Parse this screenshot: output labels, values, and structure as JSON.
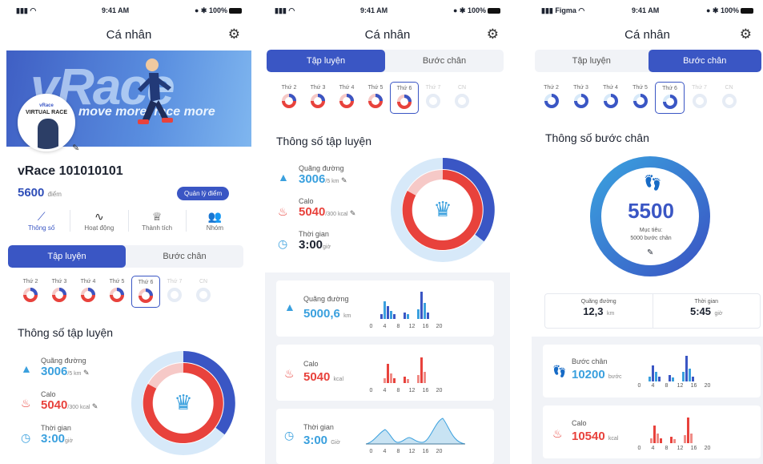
{
  "status": {
    "carrier3": "Figma",
    "time": "9:41 AM",
    "battery": "100%"
  },
  "title": "Cá nhân",
  "profile": {
    "banner_big": "vRace",
    "banner_tag": "move more, race more",
    "avatar_top": "vRace",
    "avatar_title": "VIRTUAL RACE",
    "name": "vRace 101010101",
    "points": "5600",
    "points_unit": "điểm",
    "manage_btn": "Quản lý điểm"
  },
  "nav": [
    {
      "label": "Thông số",
      "icon": "chart-line-icon"
    },
    {
      "label": "Hoạt động",
      "icon": "activity-icon"
    },
    {
      "label": "Thành tích",
      "icon": "trophy-icon"
    },
    {
      "label": "Nhóm",
      "icon": "group-icon"
    }
  ],
  "tabs": {
    "train": "Tập luyện",
    "steps": "Bước chân"
  },
  "days": [
    "Thứ 2",
    "Thứ 3",
    "Thứ 4",
    "Thứ 5",
    "Thứ 6",
    "Thứ 7",
    "CN"
  ],
  "train_title": "Thông số tập luyện",
  "steps_title": "Thông số bước chân",
  "train_stats": {
    "distance": {
      "label": "Quãng đường",
      "value": "3006",
      "unit": "/5 km"
    },
    "calo": {
      "label": "Calo",
      "value": "5040",
      "unit": "/300 kcal"
    },
    "time": {
      "label": "Thời gian",
      "value": "3:00",
      "unit": "giờ"
    }
  },
  "cards2": {
    "distance": {
      "label": "Quãng đường",
      "value": "5000,6",
      "unit": "km"
    },
    "calo": {
      "label": "Calo",
      "value": "5040",
      "unit": "kcal"
    },
    "time": {
      "label": "Thời gian",
      "value": "3:00",
      "unit": "Giờ"
    },
    "axis": [
      "0",
      "4",
      "8",
      "12",
      "16",
      "20"
    ]
  },
  "steps": {
    "value": "5500",
    "goal_label": "Mục tiêu:",
    "goal_value": "5000 bước chân",
    "distance_label": "Quãng đường",
    "distance": "12,3",
    "distance_unit": "km",
    "time_label": "Thời gian",
    "time": "5:45",
    "time_unit": "giờ"
  },
  "cards3": {
    "steps": {
      "label": "Bước chân",
      "value": "10200",
      "unit": "bước"
    },
    "calo": {
      "label": "Calo",
      "value": "10540",
      "unit": "kcal"
    }
  },
  "colors": {
    "primary": "#3a56c4",
    "blue": "#3aa0de",
    "red": "#e8423c",
    "light": "#d7e9f9"
  }
}
